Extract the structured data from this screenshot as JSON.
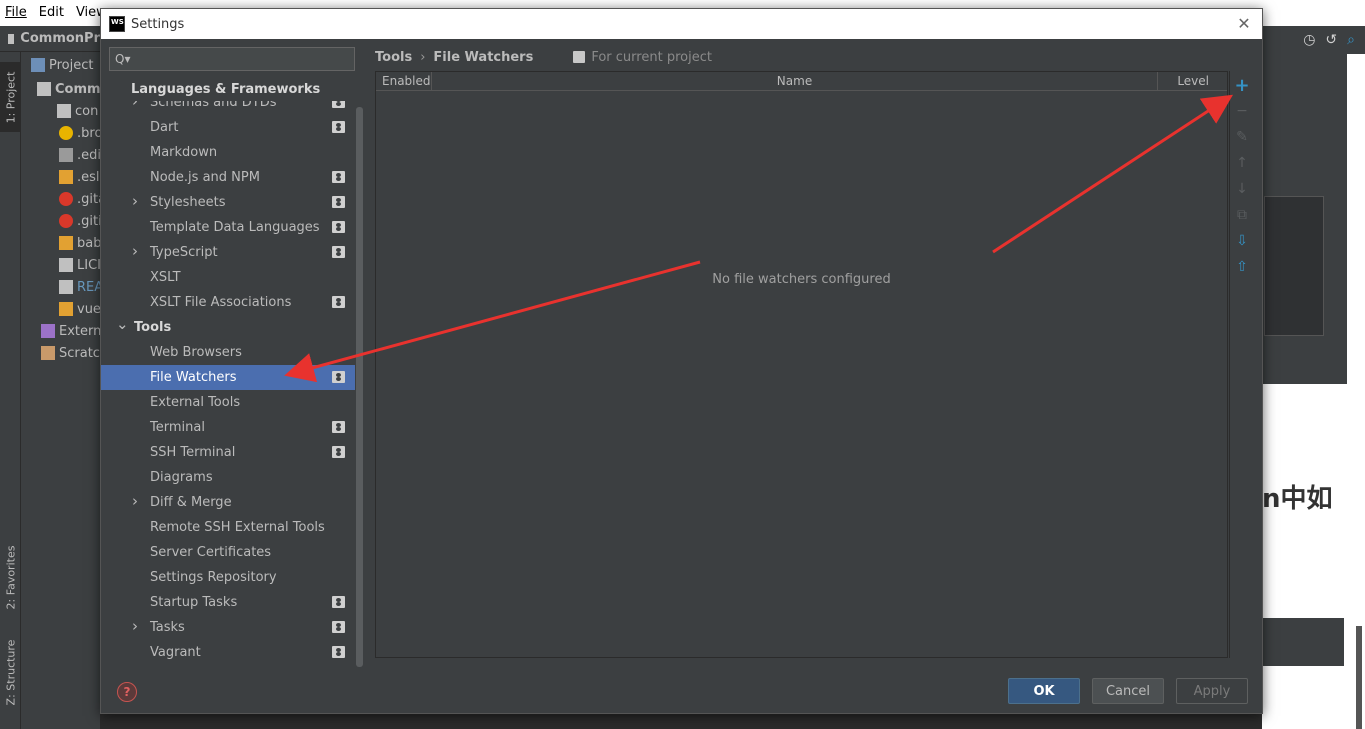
{
  "ide": {
    "menu": [
      "File",
      "Edit",
      "View"
    ],
    "project_name": "CommonPr",
    "project_tab": "Project",
    "tree_items": [
      {
        "label": "Comm",
        "kind": "folder-bold"
      },
      {
        "label": "con",
        "kind": "folder"
      },
      {
        "label": ".bro",
        "kind": "star"
      },
      {
        "label": ".edi",
        "kind": "gear"
      },
      {
        "label": ".esli",
        "kind": "js"
      },
      {
        "label": ".gita",
        "kind": "git"
      },
      {
        "label": ".giti",
        "kind": "git"
      },
      {
        "label": "bab",
        "kind": "js"
      },
      {
        "label": "LICI",
        "kind": "copyright"
      },
      {
        "label": "REA",
        "kind": "readme"
      },
      {
        "label": "vue",
        "kind": "js"
      },
      {
        "label": "Extern",
        "kind": "lib"
      },
      {
        "label": "Scratc",
        "kind": "scratch"
      }
    ],
    "left_tabs": [
      "1: Project",
      "2: Favorites",
      "Z: Structure"
    ],
    "right_text": "n中如"
  },
  "dialog": {
    "title": "Settings",
    "logo_text": "WS",
    "search_placeholder": "Q▾",
    "tree": {
      "header": "Languages & Frameworks",
      "items": [
        {
          "label": "Schemas and DTDs",
          "level": 2,
          "expandable": true,
          "project": true
        },
        {
          "label": "Dart",
          "level": 2,
          "expandable": false,
          "project": true
        },
        {
          "label": "Markdown",
          "level": 2,
          "expandable": false,
          "project": false
        },
        {
          "label": "Node.js and NPM",
          "level": 2,
          "expandable": false,
          "project": true
        },
        {
          "label": "Stylesheets",
          "level": 2,
          "expandable": true,
          "project": true
        },
        {
          "label": "Template Data Languages",
          "level": 2,
          "expandable": false,
          "project": true
        },
        {
          "label": "TypeScript",
          "level": 2,
          "expandable": true,
          "project": true
        },
        {
          "label": "XSLT",
          "level": 2,
          "expandable": false,
          "project": false
        },
        {
          "label": "XSLT File Associations",
          "level": 2,
          "expandable": false,
          "project": true
        },
        {
          "label": "Tools",
          "level": 1,
          "expandable": true,
          "expanded": true,
          "project": false
        },
        {
          "label": "Web Browsers",
          "level": 2,
          "expandable": false,
          "project": false
        },
        {
          "label": "File Watchers",
          "level": 2,
          "expandable": false,
          "project": true,
          "selected": true
        },
        {
          "label": "External Tools",
          "level": 2,
          "expandable": false,
          "project": false
        },
        {
          "label": "Terminal",
          "level": 2,
          "expandable": false,
          "project": true
        },
        {
          "label": "SSH Terminal",
          "level": 2,
          "expandable": false,
          "project": true
        },
        {
          "label": "Diagrams",
          "level": 2,
          "expandable": false,
          "project": false
        },
        {
          "label": "Diff & Merge",
          "level": 2,
          "expandable": true,
          "project": false
        },
        {
          "label": "Remote SSH External Tools",
          "level": 2,
          "expandable": false,
          "project": false
        },
        {
          "label": "Server Certificates",
          "level": 2,
          "expandable": false,
          "project": false
        },
        {
          "label": "Settings Repository",
          "level": 2,
          "expandable": false,
          "project": false
        },
        {
          "label": "Startup Tasks",
          "level": 2,
          "expandable": false,
          "project": true
        },
        {
          "label": "Tasks",
          "level": 2,
          "expandable": true,
          "project": true
        },
        {
          "label": "Vagrant",
          "level": 2,
          "expandable": false,
          "project": true
        }
      ]
    },
    "breadcrumb": {
      "parent": "Tools",
      "separator": "›",
      "current": "File Watchers",
      "scope": "For current project"
    },
    "table": {
      "columns": [
        "Enabled",
        "Name",
        "Level"
      ],
      "empty_text": "No file watchers configured"
    },
    "side_tools": [
      {
        "icon": "add-icon",
        "glyph": "+",
        "enabled": true
      },
      {
        "icon": "remove-icon",
        "glyph": "−",
        "enabled": false
      },
      {
        "icon": "edit-icon",
        "glyph": "✎",
        "enabled": false
      },
      {
        "icon": "move-up-icon",
        "glyph": "↑",
        "enabled": false
      },
      {
        "icon": "move-down-icon",
        "glyph": "↓",
        "enabled": false
      },
      {
        "icon": "copy-icon",
        "glyph": "⧉",
        "enabled": false
      },
      {
        "icon": "import-icon",
        "glyph": "⇩",
        "enabled": true
      },
      {
        "icon": "export-icon",
        "glyph": "⇧",
        "enabled": true
      }
    ],
    "buttons": {
      "ok": "OK",
      "cancel": "Cancel",
      "apply": "Apply",
      "help": "?"
    }
  },
  "colors": {
    "selection": "#4b6eaf",
    "accent_blue": "#3592c4",
    "annotation_red": "#e8322e",
    "ok_button": "#365880"
  }
}
